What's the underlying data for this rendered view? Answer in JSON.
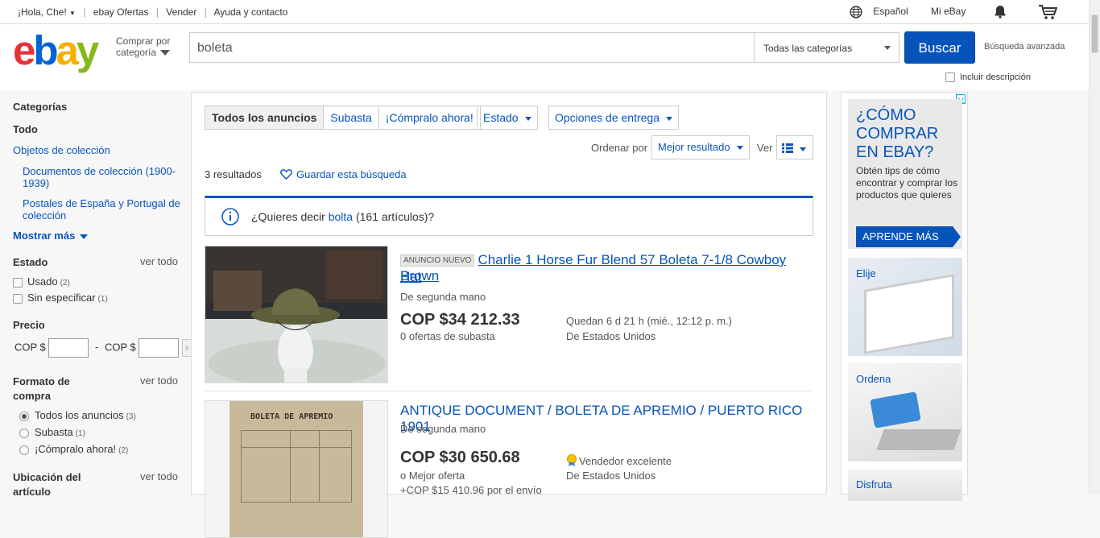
{
  "topbar": {
    "greeting": "¡Hola, Che!",
    "link_deals": "ebay Ofertas",
    "link_sell": "Vender",
    "link_help": "Ayuda y contacto",
    "language": "Español",
    "myebay": "Mi eBay"
  },
  "header": {
    "shop_by_line1": "Comprar por",
    "shop_by_line2": "categoría",
    "search_value": "boleta",
    "category_select": "Todas las categorías",
    "search_button": "Buscar",
    "advanced": "Búsqueda avanzada",
    "include_desc": "Incluir descripción"
  },
  "sidebar": {
    "categories_title": "Categorías",
    "all": "Todo",
    "collectibles": "Objetos de colección",
    "subcat1": "Documentos de colección (1900-1939)",
    "subcat2": "Postales de España y Portugal de colección",
    "show_more": "Mostrar más",
    "state_title": "Estado",
    "see_all": "ver todo",
    "used": "Usado",
    "used_count": "(2)",
    "unspecified": "Sin especificar",
    "unspecified_count": "(1)",
    "price_title": "Precio",
    "price_from": "COP $",
    "price_dash": "-",
    "price_to": "COP $",
    "format_title_1": "Formato de",
    "format_title_2": "compra",
    "format_all": "Todos los anuncios",
    "format_all_count": "(3)",
    "format_auction": "Subasta",
    "format_auction_count": "(1)",
    "format_buynow": "¡Cómpralo ahora!",
    "format_buynow_count": "(2)",
    "location_title_1": "Ubicación del",
    "location_title_2": "artículo"
  },
  "main": {
    "tab_all": "Todos los anuncios",
    "tab_auction": "Subasta",
    "tab_buynow": "¡Cómpralo ahora!",
    "filter_state": "Estado",
    "filter_delivery": "Opciones de entrega",
    "sort_label": "Ordenar por",
    "sort_value": "Mejor resultado",
    "view_label": "Ver",
    "results": "3 resultados",
    "save_search": "Guardar esta búsqueda",
    "didyou_prefix": "¿Quieres decir",
    "didyou_term": "bolta",
    "didyou_suffix": "(161 artículos)?",
    "items": [
      {
        "badge": "ANUNCIO NUEVO",
        "title_line1": "Charlie 1 Horse Fur Blend 57 Boleta 7-1/8 Cowboy Hat",
        "title_line2": "Brown",
        "condition": "De segunda mano",
        "price": "COP $34 212.33",
        "bids": "0 ofertas de subasta",
        "time_left": "Quedan 6 d 21 h (mié., 12:12 p. m.)",
        "origin": "De Estados Unidos"
      },
      {
        "title": "ANTIQUE DOCUMENT / BOLETA DE APREMIO / PUERTO RICO 1901",
        "condition": "De segunda mano",
        "price": "COP $30 650.68",
        "best_offer": "o Mejor oferta",
        "shipping": "+COP $15 410.96 por el envío",
        "seller": "Vendedor excelente",
        "origin": "De Estados Unidos",
        "doc_heading": "BOLETA DE APREMIO"
      }
    ]
  },
  "ad": {
    "headline": "¿CÓMO COMPRAR EN EBAY?",
    "body": "Obtén tips de cómo encontrar y comprar los productos que quieres",
    "cta": "APRENDE MÁS",
    "step1": "Elije",
    "step2": "Ordena",
    "step3": "Disfruta"
  },
  "colors": {
    "brand_blue": "#0654ba",
    "logo_e": "#e53238",
    "logo_b": "#0064d2",
    "logo_a": "#f5af02",
    "logo_y": "#86b817"
  }
}
